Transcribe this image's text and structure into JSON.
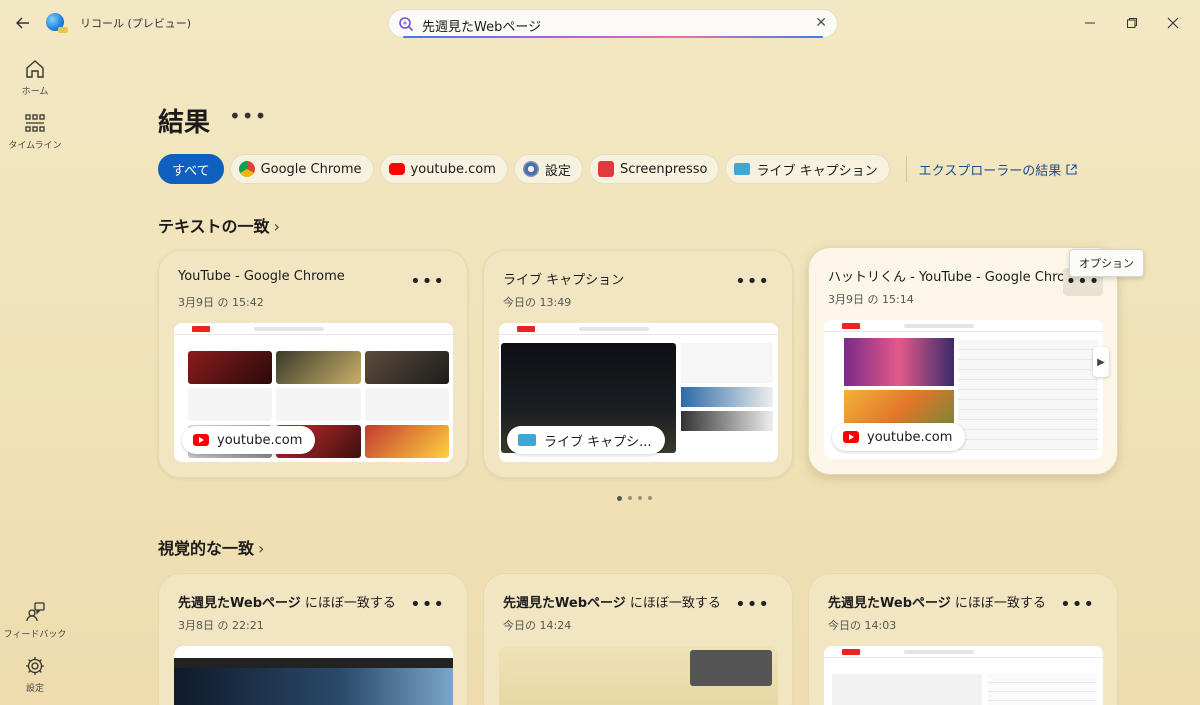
{
  "titlebar": {
    "app_title": "リコール (プレビュー)",
    "search_value": "先週見たWebページ"
  },
  "nav": {
    "home": "ホーム",
    "timeline": "タイムライン",
    "feedback": "フィードバック",
    "settings": "設定"
  },
  "main": {
    "title": "結果",
    "more": "•••",
    "filters": [
      {
        "label": "すべて",
        "active": true
      },
      {
        "label": "Google Chrome",
        "icon": "chrome-icon"
      },
      {
        "label": "youtube.com",
        "icon": "youtube-icon"
      },
      {
        "label": "設定",
        "icon": "gear-icon"
      },
      {
        "label": "Screenpresso",
        "icon": "screenpresso-icon"
      },
      {
        "label": "ライブ キャプション",
        "icon": "live-caption-icon"
      }
    ],
    "explorer_link": "エクスプローラーの結果",
    "text_section": "テキストの一致",
    "visual_section": "視覚的な一致",
    "tooltip": "オプション",
    "text_cards": [
      {
        "title": "YouTube - Google Chrome",
        "date": "3月9日 の 15:42",
        "badge": "youtube.com"
      },
      {
        "title": "ライブ キャプション",
        "date": "今日の 13:49",
        "badge": "ライブ キャプシ..."
      },
      {
        "title": "ハットリくん - YouTube - Google Chrome",
        "date": "3月9日 の 15:14",
        "badge": "youtube.com"
      }
    ],
    "visual_cards": [
      {
        "title_bold": "先週見たWebページ",
        "title_rest": " にほぼ一致する",
        "date": "3月8日 の 22:21"
      },
      {
        "title_bold": "先週見たWebページ",
        "title_rest": " にほぼ一致する",
        "date": "今日の 14:24"
      },
      {
        "title_bold": "先週見たWebページ",
        "title_rest": " にほぼ一致する",
        "date": "今日の 14:03"
      }
    ]
  }
}
